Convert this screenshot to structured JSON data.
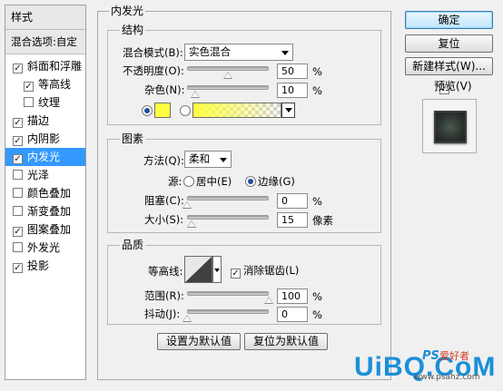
{
  "styles_panel": {
    "title": "样式",
    "blending_options": "混合选项:自定",
    "items": [
      {
        "label": "斜面和浮雕",
        "checked": true,
        "sub": false,
        "selected": false
      },
      {
        "label": "等高线",
        "checked": true,
        "sub": true,
        "selected": false
      },
      {
        "label": "纹理",
        "checked": false,
        "sub": true,
        "selected": false
      },
      {
        "label": "描边",
        "checked": true,
        "sub": false,
        "selected": false
      },
      {
        "label": "内阴影",
        "checked": true,
        "sub": false,
        "selected": false
      },
      {
        "label": "内发光",
        "checked": true,
        "sub": false,
        "selected": true
      },
      {
        "label": "光泽",
        "checked": false,
        "sub": false,
        "selected": false
      },
      {
        "label": "颜色叠加",
        "checked": false,
        "sub": false,
        "selected": false
      },
      {
        "label": "渐变叠加",
        "checked": false,
        "sub": false,
        "selected": false
      },
      {
        "label": "图案叠加",
        "checked": true,
        "sub": false,
        "selected": false
      },
      {
        "label": "外发光",
        "checked": false,
        "sub": false,
        "selected": false
      },
      {
        "label": "投影",
        "checked": true,
        "sub": false,
        "selected": false
      }
    ]
  },
  "inner_glow": {
    "title": "内发光",
    "structure": {
      "title": "结构",
      "blend_mode_label": "混合模式(B):",
      "blend_mode_value": "实色混合",
      "opacity_label": "不透明度(O):",
      "opacity_value": "50",
      "opacity_percent": 50,
      "noise_label": "杂色(N):",
      "noise_value": "10",
      "noise_percent": 10,
      "unit": "%",
      "color_swatch": "#ffff40",
      "gradient_from": "#ffff40"
    },
    "elements": {
      "title": "图素",
      "technique_label": "方法(Q):",
      "technique_value": "柔和",
      "source_label": "源:",
      "center_label": "居中(E)",
      "edge_label": "边缘(G)",
      "choke_label": "阻塞(C):",
      "choke_value": "0",
      "choke_percent": 0,
      "size_label": "大小(S):",
      "size_value": "15",
      "size_percent": 6,
      "size_unit": "像素",
      "percent_unit": "%"
    },
    "quality": {
      "title": "品质",
      "contour_label": "等高线:",
      "anti_alias_label": "消除锯齿(L)",
      "anti_alias_checked": true,
      "range_label": "范围(R):",
      "range_value": "100",
      "range_percent": 100,
      "jitter_label": "抖动(J):",
      "jitter_value": "0",
      "jitter_percent": 0,
      "unit": "%"
    },
    "set_default_label": "设置为默认值",
    "reset_default_label": "复位为默认值"
  },
  "right_buttons": {
    "ok": "确定",
    "reset": "复位",
    "new_style": "新建样式(W)...",
    "preview_label": "预览(V)",
    "preview_checked": true
  },
  "watermark": {
    "brand": "UiBQ.CoM",
    "ps_text": "PS",
    "cn_text": "爱好者",
    "site": "www.psahz.com"
  },
  "colors": {
    "selection": "#3399ff",
    "brand_blue": "#1a8fd8"
  }
}
